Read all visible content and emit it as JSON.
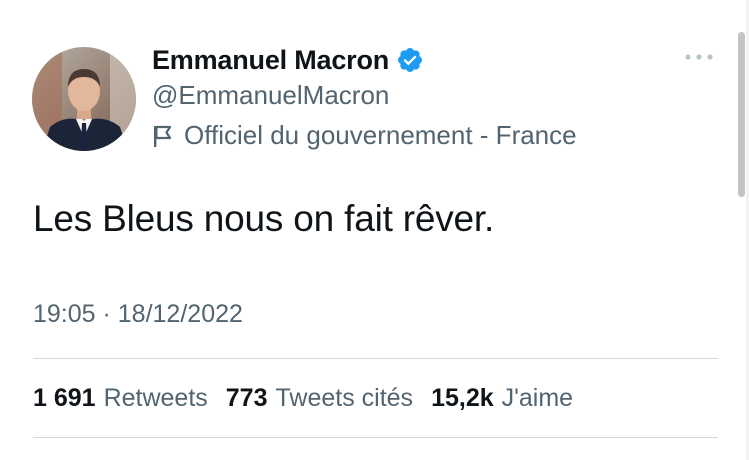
{
  "author": {
    "display_name": "Emmanuel Macron",
    "handle": "@EmmanuelMacron",
    "verified": true,
    "label": "Officiel du gouvernement - France",
    "label_icon": "flag-icon",
    "avatar": "avatar"
  },
  "tweet": {
    "text": "Les Bleus nous on fait rêver.",
    "timestamp": "19:05 · 18/12/2022"
  },
  "stats": [
    {
      "value": "1 691",
      "label": "Retweets"
    },
    {
      "value": "773",
      "label": "Tweets cités"
    },
    {
      "value": "15,2k",
      "label": "J'aime"
    }
  ],
  "icons": {
    "more": "more-options-icon",
    "verified": "verified-badge-icon"
  },
  "colors": {
    "text_primary": "#0f1419",
    "text_secondary": "#536471",
    "verified_blue": "#1d9bf0",
    "divider": "#cfd9de"
  }
}
